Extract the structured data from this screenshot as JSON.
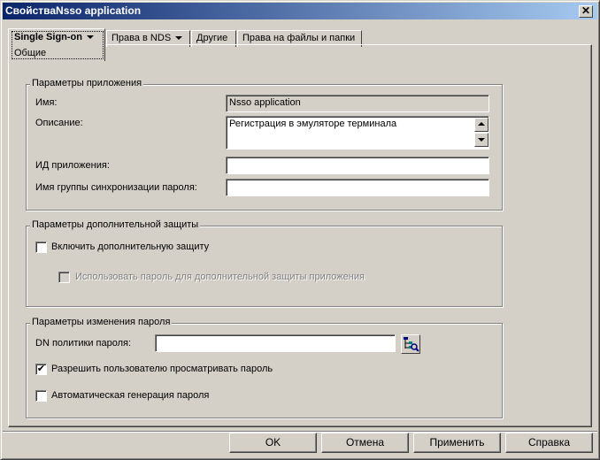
{
  "window": {
    "title": "СвойстваNsso application",
    "close_glyph": "✕"
  },
  "tabs": {
    "active": {
      "label": "Single Sign-on",
      "sub_label": "Общие"
    },
    "items": [
      {
        "label": "Права в NDS"
      },
      {
        "label": "Другие"
      },
      {
        "label": "Права на файлы и папки"
      }
    ]
  },
  "app_params": {
    "title": "Параметры приложения",
    "name_label": "Имя:",
    "name_value": "Nsso application",
    "description_label": "Описание:",
    "description_value": "Регистрация в эмуляторе терминала",
    "app_id_label": "ИД приложения:",
    "app_id_value": "",
    "sync_group_label": "Имя группы синхронизации пароля:",
    "sync_group_value": ""
  },
  "extra_security": {
    "title": "Параметры дополнительной защиты",
    "enable_label": "Включить дополнительную защиту",
    "enable_checked": false,
    "use_password_label": "Использовать пароль для дополнительной защиты приложения",
    "use_password_checked": false
  },
  "password_change": {
    "title": "Параметры изменения пароля",
    "dn_label": "DN политики пароля:",
    "dn_value": "",
    "allow_view_label": "Разрешить пользователю просматривать пароль",
    "allow_view_checked": true,
    "allow_view_mark": "✔",
    "auto_gen_label": "Автоматическая генерация пароля",
    "auto_gen_checked": false
  },
  "buttons": {
    "ok": "OK",
    "cancel": "Отмена",
    "apply": "Применить",
    "help": "Справка"
  },
  "icons": {
    "browse": "directory-browse-icon"
  }
}
